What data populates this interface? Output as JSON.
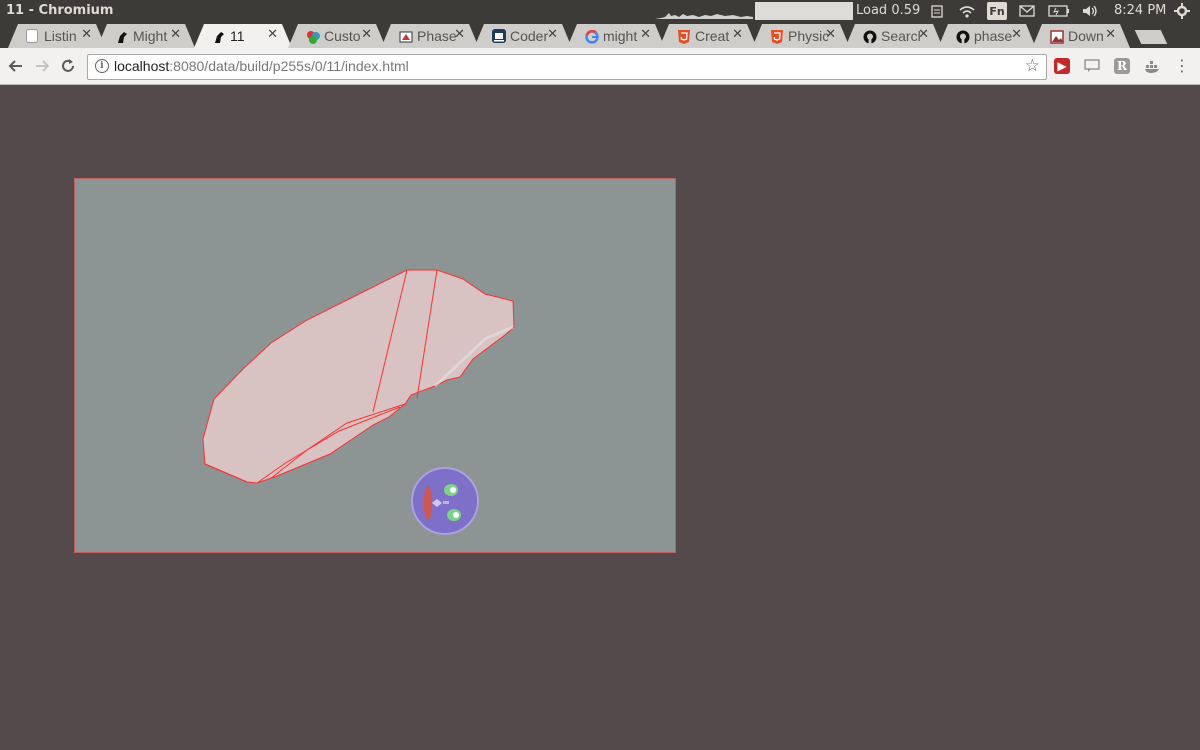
{
  "os_panel": {
    "window_title": "11 - Chromium",
    "load_label": "Load 0.59",
    "fn_label": "Fn",
    "clock": "8:24 PM"
  },
  "tabs": [
    {
      "label": "Listin",
      "icon": "document-icon",
      "active": false
    },
    {
      "label": "Might",
      "icon": "mighty-icon",
      "active": false
    },
    {
      "label": "11",
      "icon": "mighty-icon",
      "active": true
    },
    {
      "label": "Custo",
      "icon": "custom-icon",
      "active": false
    },
    {
      "label": "Phase",
      "icon": "phaser-icon",
      "active": false
    },
    {
      "label": "Coder",
      "icon": "coder-icon",
      "active": false
    },
    {
      "label": "might",
      "icon": "google-icon",
      "active": false
    },
    {
      "label": "Creat",
      "icon": "html5-icon",
      "active": false
    },
    {
      "label": "Physic",
      "icon": "html5-icon",
      "active": false
    },
    {
      "label": "Searcl",
      "icon": "github-icon",
      "active": false
    },
    {
      "label": "phase",
      "icon": "github-icon",
      "active": false
    },
    {
      "label": "Down",
      "icon": "image-icon",
      "active": false
    }
  ],
  "toolbar": {
    "url_host": "localhost",
    "url_path": ":8080/data/build/p255s/0/11/index.html"
  },
  "colors": {
    "page_background": "#544a4b",
    "canvas_background": "#8c9494",
    "rock_fill": "#d8c2c2",
    "outline": "#ff3030",
    "character": "#7e6fc8"
  }
}
